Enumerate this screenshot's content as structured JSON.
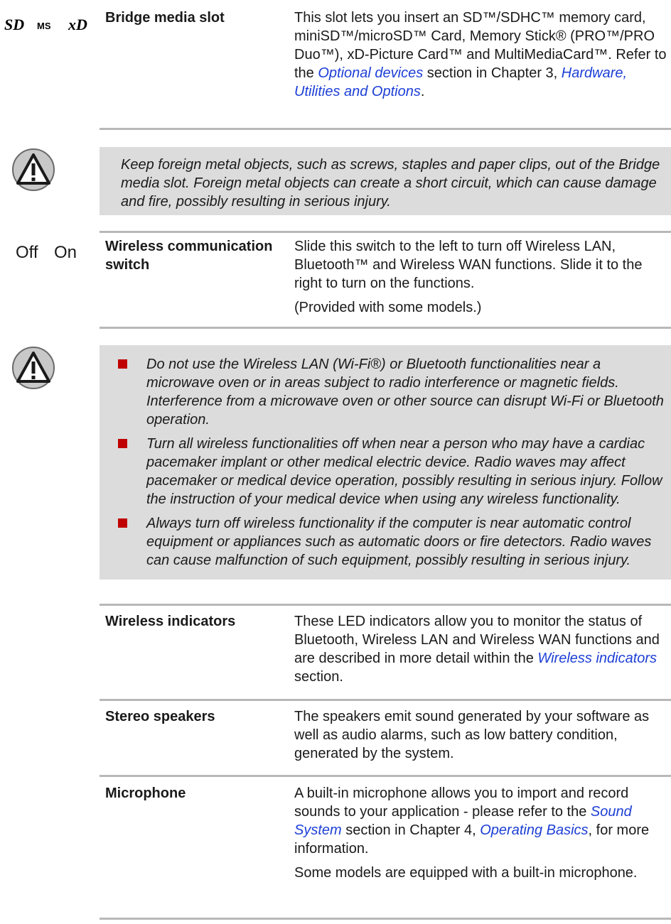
{
  "bridge": {
    "logos": [
      "SD",
      "MS",
      "xD"
    ],
    "term": "Bridge media slot",
    "desc_before_link": "This slot lets you insert an SD™/SDHC™ memory card, miniSD™/microSD™ Card, Memory Stick® (PRO™/PRO Duo™), xD-Picture Card™ and MultiMediaCard™. Refer to the ",
    "link1": "Optional devices",
    "desc_mid": " section in Chapter 3, ",
    "link2": "Hardware, Utilities and Options",
    "desc_end": "."
  },
  "warning1": "Keep foreign metal objects, such as screws, staples and paper clips, out of the Bridge media slot. Foreign metal objects can create a short circuit, which can cause damage and fire, possibly resulting in serious injury.",
  "wireless_switch": {
    "off_label": "Off",
    "on_label": "On",
    "term": "Wireless communication switch",
    "desc": "Slide this switch to the left to turn off Wireless LAN, Bluetooth™ and Wireless WAN functions. Slide it to the right to turn on the functions.",
    "note": "(Provided with some models.)"
  },
  "warning2": [
    "Do not use the Wireless LAN (Wi-Fi®) or Bluetooth functionalities near a microwave oven or in areas subject to radio interference or magnetic fields. Interference from a microwave oven or other source can disrupt Wi-Fi or Bluetooth operation.",
    "Turn all wireless functionalities off when near a person who may have a cardiac pacemaker implant or other medical electric device. Radio waves may affect pacemaker or medical device operation, possibly resulting in serious injury. Follow the instruction of your medical device when using any wireless functionality.",
    "Always turn off wireless functionality if the computer is near automatic control equipment or appliances such as automatic doors or fire detectors. Radio waves can cause malfunction of such equipment, possibly resulting in serious injury."
  ],
  "wireless_indicators": {
    "term": "Wireless indicators",
    "desc_before_link": "These LED indicators allow you to monitor the status of Bluetooth, Wireless LAN and Wireless WAN functions and are described in more detail within the ",
    "link": "Wireless indicators",
    "desc_after_link": " section."
  },
  "stereo_speakers": {
    "term": "Stereo speakers",
    "desc": "The speakers emit sound generated by your software as well as audio alarms, such as low battery condition, generated by the system."
  },
  "microphone": {
    "term": "Microphone",
    "desc_before_link": "A built-in microphone allows you to import and record sounds to your application - please refer to the ",
    "link1": "Sound System",
    "desc_mid": " section in Chapter 4, ",
    "link2": "Operating Basics",
    "desc_end": ", for more information.",
    "note": "Some models are equipped with a built-in microphone."
  }
}
